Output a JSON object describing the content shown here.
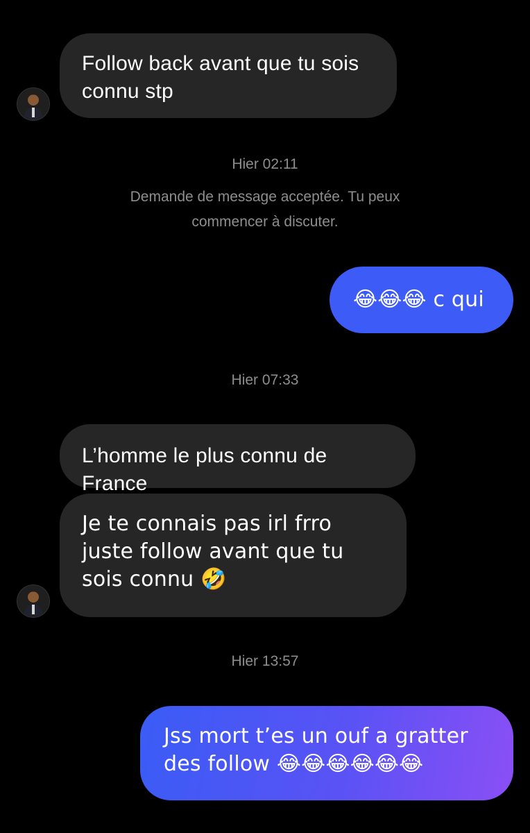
{
  "conversation": {
    "messages": [
      {
        "kind": "incoming",
        "text": "Follow back avant que tu sois connu stp"
      },
      {
        "kind": "timestamp",
        "text": "Hier 02:11"
      },
      {
        "kind": "system",
        "text": "Demande de message acceptée. Tu peux commencer à discuter."
      },
      {
        "kind": "outgoing",
        "text": "😂😂😂 c qui"
      },
      {
        "kind": "timestamp",
        "text": "Hier 07:33"
      },
      {
        "kind": "incoming",
        "text": "L’homme le plus connu de France"
      },
      {
        "kind": "incoming",
        "text": "Je te connais pas irl frro juste follow avant que tu sois connu 🤣"
      },
      {
        "kind": "timestamp",
        "text": "Hier 13:57"
      },
      {
        "kind": "outgoing",
        "text": "Jss mort t’es un ouf a gratter des follow 😂😂😂😂😂😂"
      }
    ]
  },
  "avatar_icon": "person-avatar-icon",
  "colors": {
    "background": "#000000",
    "incoming_bubble": "#262626",
    "outgoing_blue": "#3a5cf5",
    "outgoing_purple": "#8a4ff5",
    "timestamp_text": "#8e8e8e"
  }
}
